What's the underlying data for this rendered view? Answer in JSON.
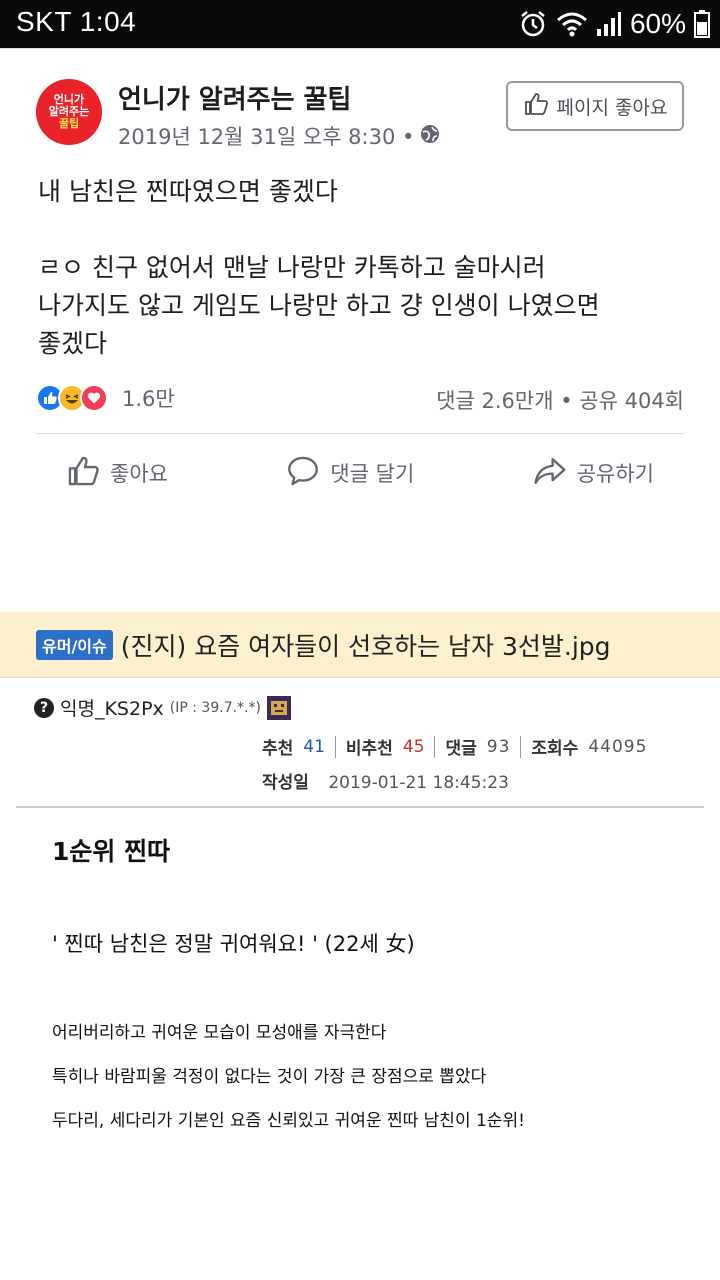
{
  "status_bar": {
    "carrier_time": "SKT 1:04",
    "battery": "60%"
  },
  "fb_post": {
    "page_name": "언니가 알려주는 꿀팁",
    "avatar_text": [
      "언니가",
      "알려주는",
      "꿀팁"
    ],
    "timestamp": "2019년 12월 31일 오후 8:30 •",
    "like_page_label": "페이지 좋아요",
    "text": "내 남친은 찐따였으면 좋겠다\n\nㄹㅇ 친구 없어서 맨날 나랑만 카톡하고 술마시러\n나가지도 않고 게임도 나랑만 하고 걍 인생이 나였으면\n좋겠다",
    "reaction_count": "1.6만",
    "comments_shares": "댓글 2.6만개 • 공유 404회",
    "actions": {
      "like": "좋아요",
      "comment": "댓글 달기",
      "share": "공유하기"
    },
    "colors": {
      "avatar_bg": "#e8242a",
      "like_blue": "#1877f2",
      "haha_yellow": "#f7b928",
      "love_red": "#f33e58"
    }
  },
  "community_post": {
    "category": "유머/이슈",
    "title": "(진지) 요즘 여자들이 선호하는 남자 3선발.jpg",
    "author": "익명_KS2Px",
    "ip": "(IP : 39.7.*.*)",
    "stats": {
      "recommend_label": "추천",
      "recommend_value": "41",
      "not_recommend_label": "비추천",
      "not_recommend_value": "45",
      "comments_label": "댓글",
      "comments_value": "93",
      "views_label": "조회수",
      "views_value": "44095"
    },
    "date_label": "작성일",
    "date_value": "2019-01-21 18:45:23",
    "rank_title": "1순위 찐따",
    "quote": "' 찐따 남친은 정말 귀여워요! ' (22세 女)",
    "body_lines": [
      "어리버리하고 귀여운 모습이 모성애를 자극한다",
      "특히나 바람피울 걱정이 없다는 것이 가장 큰 장점으로 뽑았다",
      "두다리, 세다리가 기본인 요즘 신뢰있고 귀여운 찐따 남친이 1순위!"
    ],
    "colors": {
      "banner_bg": "#fdf0cf",
      "badge_bg": "#2d6fc9"
    }
  }
}
